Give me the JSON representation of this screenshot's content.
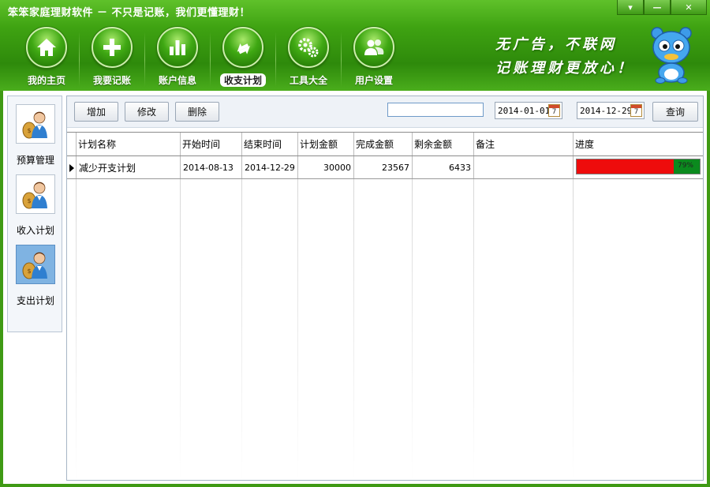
{
  "window": {
    "title": "笨笨家庭理财软件  － 不只是记账，我们更懂理财！",
    "controls": [
      "▾",
      "—",
      "✕"
    ]
  },
  "nav": {
    "items": [
      {
        "label": "我的主页",
        "icon": "home-icon"
      },
      {
        "label": "我要记账",
        "icon": "plus-icon"
      },
      {
        "label": "账户信息",
        "icon": "bar-chart-icon"
      },
      {
        "label": "收支计划",
        "icon": "exchange-arrows-icon",
        "active": true
      },
      {
        "label": "工具大全",
        "icon": "gears-icon"
      },
      {
        "label": "用户设置",
        "icon": "users-icon"
      }
    ]
  },
  "slogan": {
    "line1": "无广告，不联网",
    "line2": "记账理财更放心！"
  },
  "sidebar": {
    "items": [
      {
        "label": "预算管理",
        "icon": "money-bag-person-icon"
      },
      {
        "label": "收入计划",
        "icon": "money-bag-person-icon"
      },
      {
        "label": "支出计划",
        "icon": "money-bag-person-icon",
        "active": true
      }
    ]
  },
  "toolbar": {
    "add_label": "增加",
    "edit_label": "修改",
    "delete_label": "删除",
    "search_value": "",
    "start_date": "2014-01-01",
    "end_date": "2014-12-29",
    "calendar_day": "7",
    "query_label": "查询"
  },
  "table": {
    "columns": [
      "计划名称",
      "开始时间",
      "结束时间",
      "计划金额",
      "完成金额",
      "剩余金额",
      "备注",
      "进度"
    ],
    "rows": [
      {
        "name": "减少开支计划",
        "start": "2014-08-13",
        "end": "2014-12-29",
        "planned": "30000",
        "completed": "23567",
        "remaining": "6433",
        "note": "",
        "progress_label": "79%",
        "progress_value": 0.79
      }
    ]
  },
  "colors": {
    "header_green": "#3fa312",
    "progress_red": "#ee0c0c",
    "progress_green": "#0b8a1e"
  }
}
